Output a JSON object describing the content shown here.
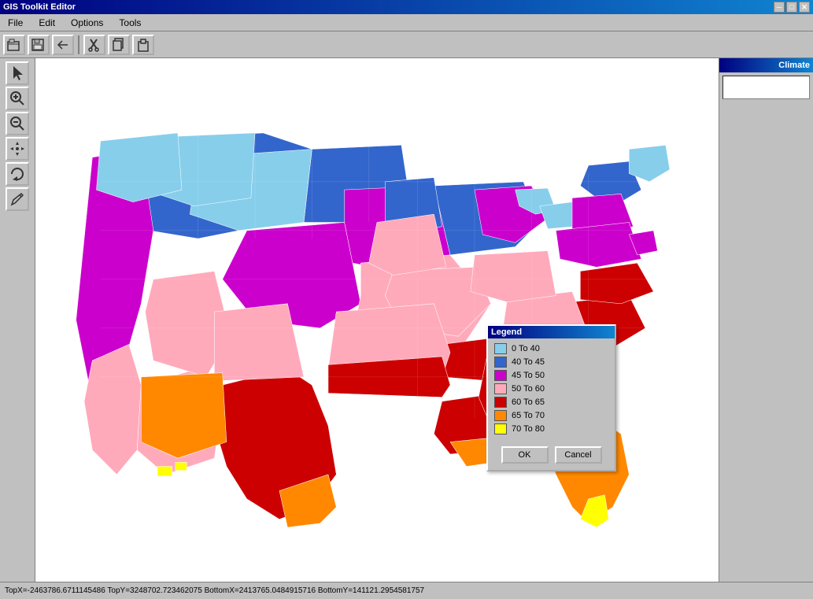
{
  "app": {
    "title": "GIS Toolkit Editor"
  },
  "title_bar_buttons": [
    "─",
    "□",
    "✕"
  ],
  "menu": {
    "items": [
      "File",
      "Edit",
      "Options",
      "Tools"
    ]
  },
  "toolbar": {
    "buttons": [
      "open",
      "save",
      "arrow-back",
      "cut",
      "copy",
      "paste"
    ]
  },
  "tools": {
    "buttons": [
      "arrow",
      "zoom-in",
      "zoom-out",
      "pan",
      "rotate",
      "draw"
    ]
  },
  "right_panel": {
    "title": "Climate"
  },
  "legend": {
    "title": "Legend",
    "items": [
      {
        "label": "0 To 40",
        "color": "#87CEEB"
      },
      {
        "label": "40 To 45",
        "color": "#3366CC"
      },
      {
        "label": "45 To 50",
        "color": "#CC00CC"
      },
      {
        "label": "50 To 60",
        "color": "#FFAABB"
      },
      {
        "label": "60 To 65",
        "color": "#CC0000"
      },
      {
        "label": "65 To 70",
        "color": "#FF8800"
      },
      {
        "label": "70 To 80",
        "color": "#FFFF00"
      }
    ],
    "ok_label": "OK",
    "cancel_label": "Cancel"
  },
  "status_bar": {
    "text": "TopX=-2463786.6711145486 TopY=3248702.723462075 BottomX=2413765.0484915716 BottomY=141121.2954581757"
  }
}
